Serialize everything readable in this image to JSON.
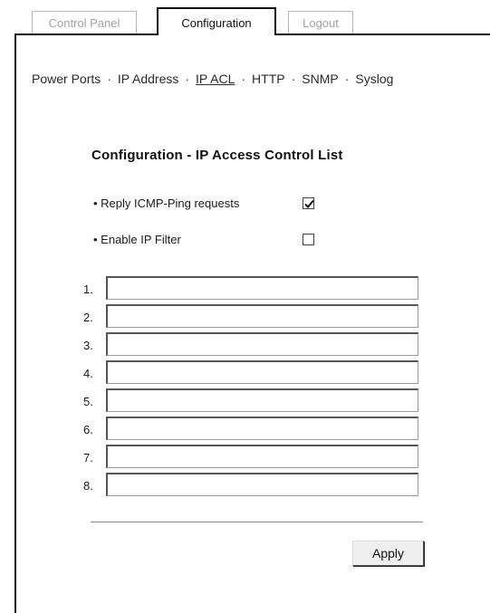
{
  "tabs": [
    {
      "label": "Control Panel",
      "active": false
    },
    {
      "label": "Configuration",
      "active": true
    },
    {
      "label": "Logout",
      "active": false
    }
  ],
  "subnav": {
    "items": [
      "Power Ports",
      "IP Address",
      "IP ACL",
      "HTTP",
      "SNMP",
      "Syslog"
    ],
    "separator": "·",
    "current": "IP ACL"
  },
  "heading": "Configuration - IP Access Control List",
  "options": [
    {
      "label": "• Reply ICMP-Ping requests",
      "checked": true
    },
    {
      "label": "• Enable IP Filter",
      "checked": false
    }
  ],
  "acl": {
    "rows": [
      {
        "number": "1.",
        "value": ""
      },
      {
        "number": "2.",
        "value": ""
      },
      {
        "number": "3.",
        "value": ""
      },
      {
        "number": "4.",
        "value": ""
      },
      {
        "number": "5.",
        "value": ""
      },
      {
        "number": "6.",
        "value": ""
      },
      {
        "number": "7.",
        "value": ""
      },
      {
        "number": "8.",
        "value": ""
      }
    ]
  },
  "apply_label": "Apply"
}
